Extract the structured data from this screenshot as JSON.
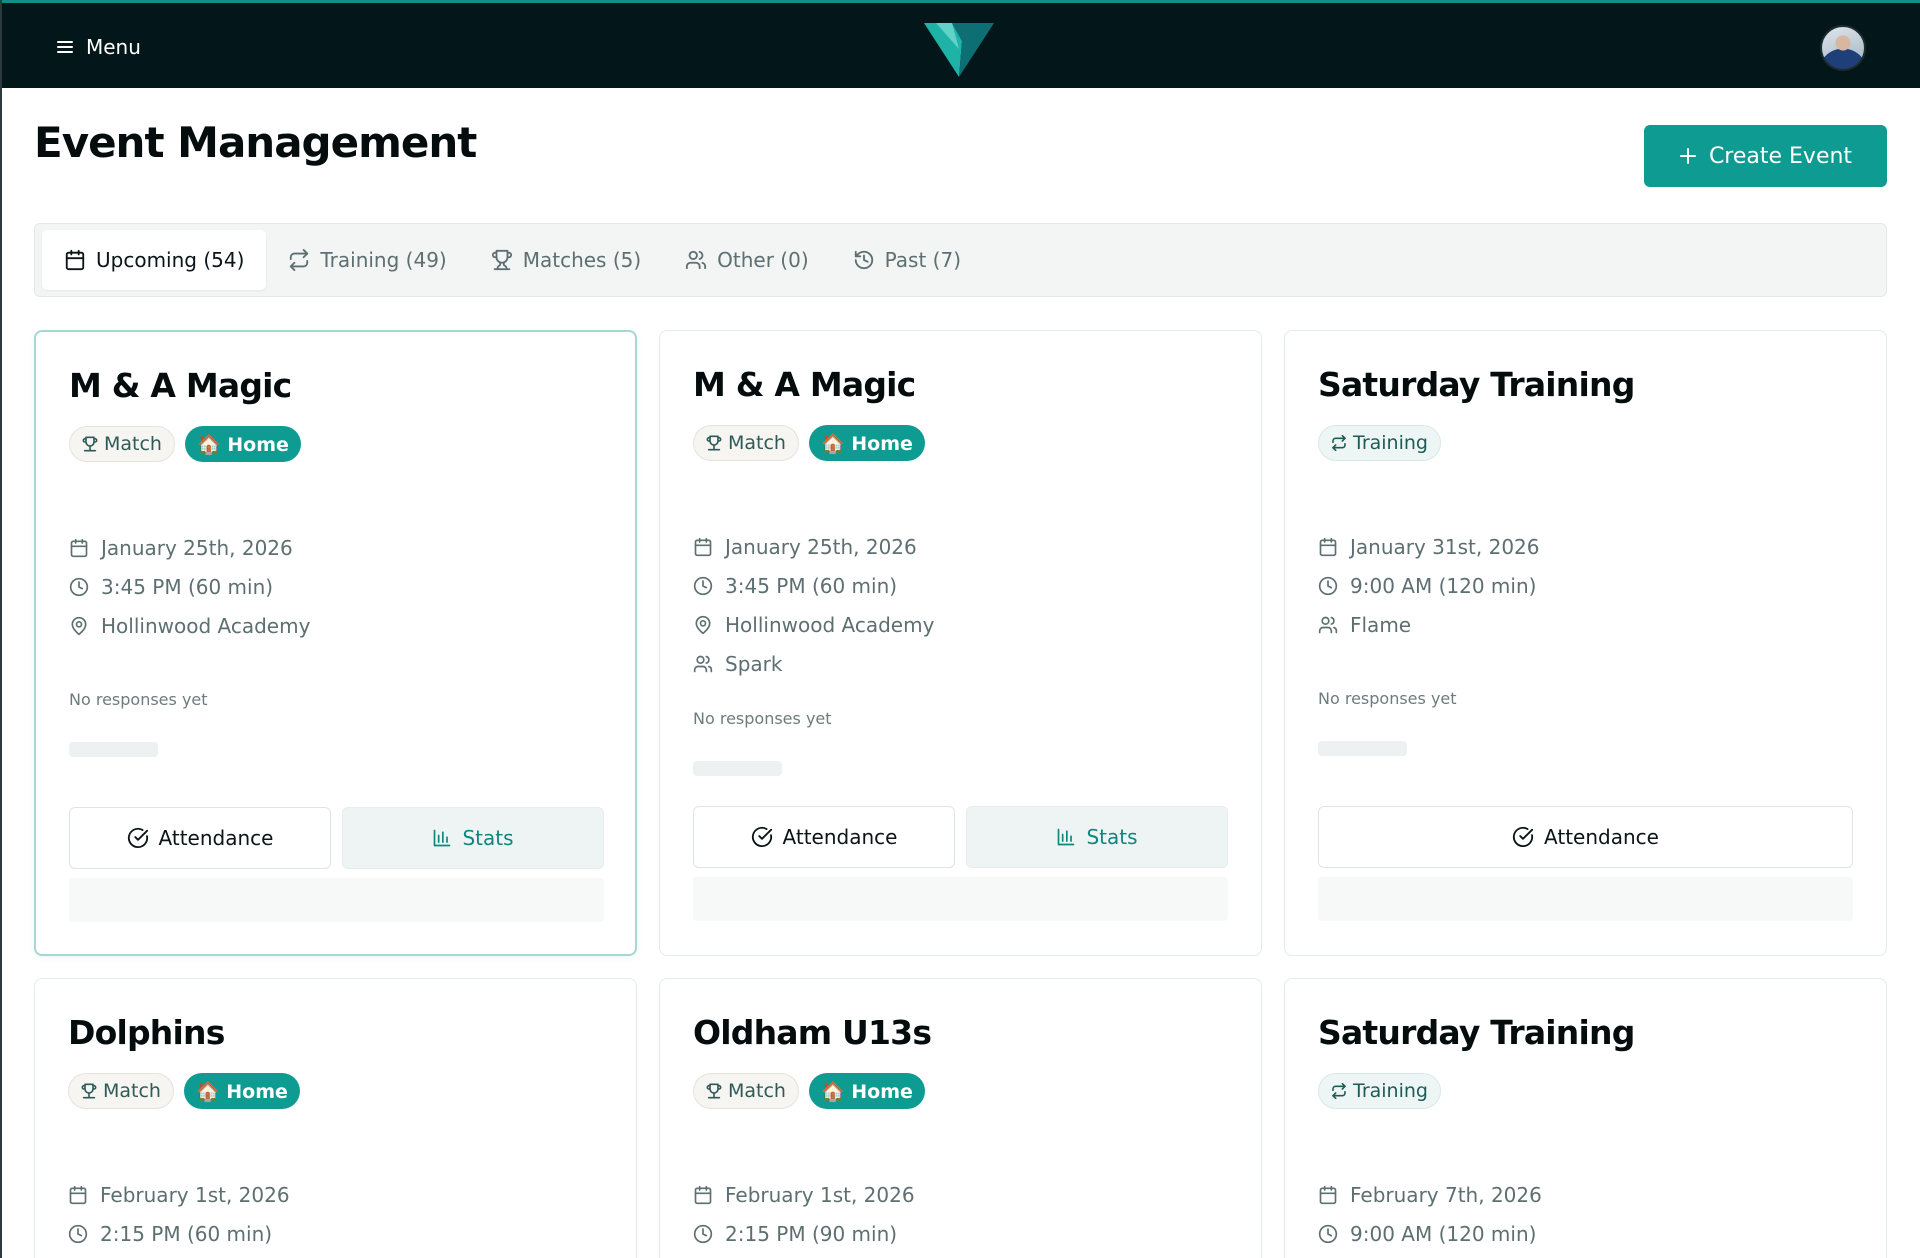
{
  "header": {
    "menu_label": "Menu"
  },
  "page": {
    "title": "Event Management",
    "create_label": "Create Event"
  },
  "tabs": [
    {
      "label": "Upcoming (54)",
      "icon": "calendar-icon"
    },
    {
      "label": "Training (49)",
      "icon": "repeat-icon"
    },
    {
      "label": "Matches (5)",
      "icon": "trophy-icon"
    },
    {
      "label": "Other (0)",
      "icon": "users-icon"
    },
    {
      "label": "Past (7)",
      "icon": "history-icon"
    }
  ],
  "cards": [
    {
      "title": "M & A Magic",
      "badges": [
        "Match",
        "🏠 Home"
      ],
      "date": "January 25th, 2026",
      "time": "3:45 PM (60 min)",
      "location": "Hollinwood Academy",
      "responses": "No responses yet",
      "attendance_label": "Attendance",
      "stats_label": "Stats"
    },
    {
      "title": "M & A Magic",
      "badges": [
        "Match",
        "🏠 Home"
      ],
      "date": "January 25th, 2026",
      "time": "3:45 PM (60 min)",
      "location": "Hollinwood Academy",
      "team": "Spark",
      "responses": "No responses yet",
      "attendance_label": "Attendance",
      "stats_label": "Stats"
    },
    {
      "title": "Saturday Training",
      "badges": [
        "Training"
      ],
      "date": "January 31st, 2026",
      "time": "9:00 AM (120 min)",
      "team": "Flame",
      "responses": "No responses yet",
      "attendance_label": "Attendance"
    },
    {
      "title": "Dolphins",
      "badges": [
        "Match",
        "🏠 Home"
      ],
      "date": "February 1st, 2026",
      "time": "2:15 PM (60 min)"
    },
    {
      "title": "Oldham U13s",
      "badges": [
        "Match",
        "🏠 Home"
      ],
      "date": "February 1st, 2026",
      "time": "2:15 PM (90 min)"
    },
    {
      "title": "Saturday Training",
      "badges": [
        "Training"
      ],
      "date": "February 7th, 2026",
      "time": "9:00 AM (120 min)"
    }
  ],
  "colors": {
    "brand": "#0e9b92",
    "topbar": "#03171a"
  }
}
